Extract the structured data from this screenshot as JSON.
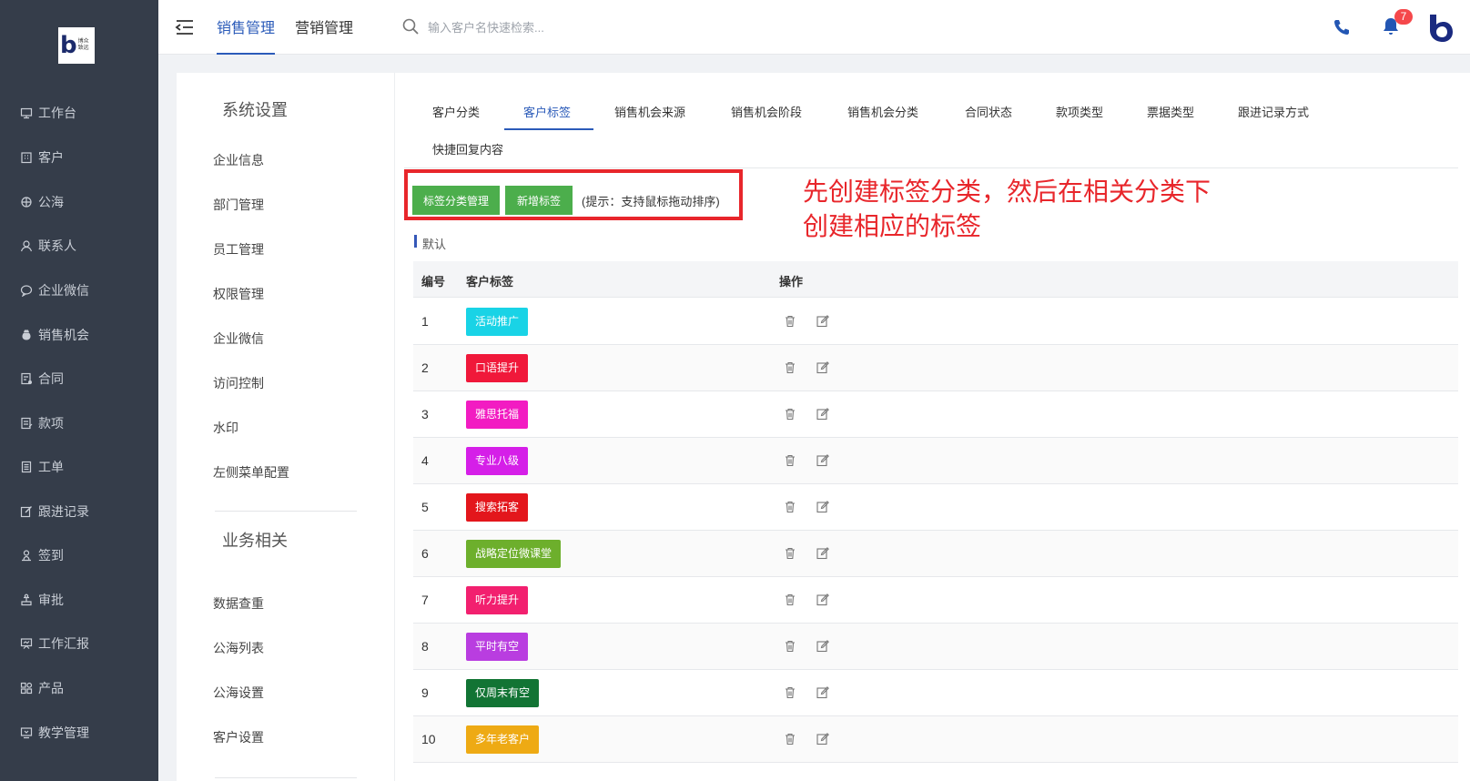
{
  "sidebar": {
    "logo_text": "博众致远",
    "items": [
      {
        "label": "工作台",
        "icon": "desktop-icon"
      },
      {
        "label": "客户",
        "icon": "building-icon"
      },
      {
        "label": "公海",
        "icon": "ship-icon"
      },
      {
        "label": "联系人",
        "icon": "user-icon"
      },
      {
        "label": "企业微信",
        "icon": "chat-icon"
      },
      {
        "label": "销售机会",
        "icon": "moneybag-icon"
      },
      {
        "label": "合同",
        "icon": "contract-icon"
      },
      {
        "label": "款项",
        "icon": "payment-icon"
      },
      {
        "label": "工单",
        "icon": "ticket-icon"
      },
      {
        "label": "跟进记录",
        "icon": "edit-icon"
      },
      {
        "label": "签到",
        "icon": "checkin-icon"
      },
      {
        "label": "审批",
        "icon": "approve-icon"
      },
      {
        "label": "工作汇报",
        "icon": "report-icon"
      },
      {
        "label": "产品",
        "icon": "grid-icon"
      },
      {
        "label": "教学管理",
        "icon": "teach-icon"
      }
    ]
  },
  "header": {
    "tabs": [
      "销售管理",
      "营销管理"
    ],
    "active_tab": 0,
    "search_placeholder": "输入客户名快速检索...",
    "notification_count": "7"
  },
  "settings": {
    "system_title": "系统设置",
    "system_items": [
      "企业信息",
      "部门管理",
      "员工管理",
      "权限管理",
      "企业微信",
      "访问控制",
      "水印",
      "左侧菜单配置"
    ],
    "business_title": "业务相关",
    "business_items": [
      "数据查重",
      "公海列表",
      "公海设置",
      "客户设置"
    ]
  },
  "content": {
    "tabs": [
      "客户分类",
      "客户标签",
      "销售机会来源",
      "销售机会阶段",
      "销售机会分类",
      "合同状态",
      "款项类型",
      "票据类型",
      "跟进记录方式",
      "快捷回复内容"
    ],
    "active_tab": 1,
    "buttons": {
      "manage_categories": "标签分类管理",
      "add_tag": "新增标签"
    },
    "hint": "(提示：支持鼠标拖动排序)",
    "annotation_line1": "先创建标签分类，然后在相关分类下",
    "annotation_line2": "创建相应的标签",
    "group_label": "默认",
    "table": {
      "headers": [
        "编号",
        "客户标签",
        "操作"
      ],
      "rows": [
        {
          "num": "1",
          "tag": "活动推广",
          "color": "#19d3e6"
        },
        {
          "num": "2",
          "tag": "口语提升",
          "color": "#f0183a"
        },
        {
          "num": "3",
          "tag": "雅思托福",
          "color": "#f21cc2"
        },
        {
          "num": "4",
          "tag": "专业八级",
          "color": "#d51fe8"
        },
        {
          "num": "5",
          "tag": "搜索拓客",
          "color": "#e3161c"
        },
        {
          "num": "6",
          "tag": "战略定位微课堂",
          "color": "#6daf2c"
        },
        {
          "num": "7",
          "tag": "听力提升",
          "color": "#f2206f"
        },
        {
          "num": "8",
          "tag": "平时有空",
          "color": "#b93de0"
        },
        {
          "num": "9",
          "tag": "仅周末有空",
          "color": "#127434"
        },
        {
          "num": "10",
          "tag": "多年老客户",
          "color": "#eeaa14"
        }
      ]
    }
  }
}
